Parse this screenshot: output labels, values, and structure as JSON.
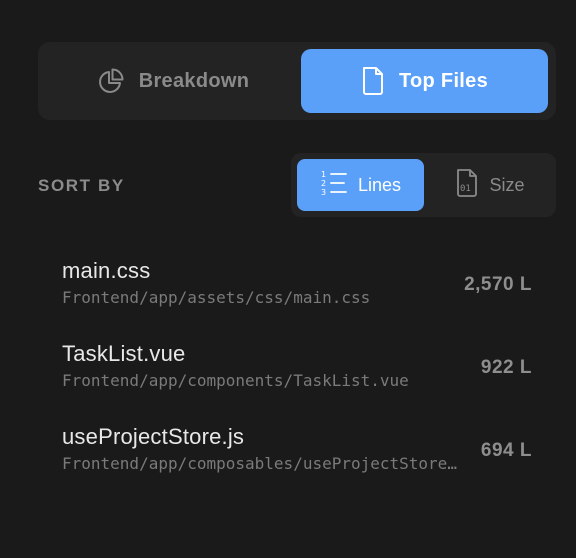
{
  "tabs": {
    "breakdown": {
      "label": "Breakdown",
      "icon": "pie-chart-icon"
    },
    "top_files": {
      "label": "Top Files",
      "icon": "file-icon",
      "active": true
    }
  },
  "sort": {
    "label": "SORT BY",
    "lines": {
      "label": "Lines",
      "icon": "numbered-list-icon",
      "active": true
    },
    "size": {
      "label": "Size",
      "icon": "binary-file-icon"
    }
  },
  "files": [
    {
      "name": "main.css",
      "path": "Frontend/app/assets/css/main.css",
      "lines": "2,570 L"
    },
    {
      "name": "TaskList.vue",
      "path": "Frontend/app/components/TaskList.vue",
      "lines": "922 L"
    },
    {
      "name": "useProjectStore.js",
      "path": "Frontend/app/composables/useProjectStore.js",
      "lines": "694 L"
    }
  ],
  "colors": {
    "accent": "#5aa0f8",
    "background": "#1a1a1a",
    "panel": "#232323"
  }
}
